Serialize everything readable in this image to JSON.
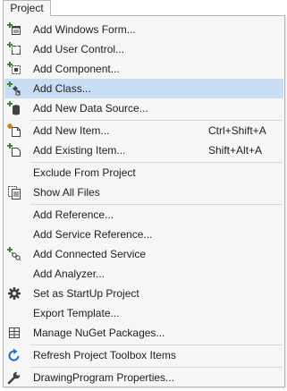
{
  "menubar": {
    "tab_label": "Project"
  },
  "menu": {
    "items": [
      {
        "label": "Add Windows Form...",
        "icon": "windows-form-icon",
        "shortcut": ""
      },
      {
        "label": "Add User Control...",
        "icon": "user-control-icon",
        "shortcut": ""
      },
      {
        "label": "Add Component...",
        "icon": "component-icon",
        "shortcut": ""
      },
      {
        "label": "Add Class...",
        "icon": "class-icon",
        "shortcut": ""
      },
      {
        "label": "Add New Data Source...",
        "icon": "data-source-icon",
        "shortcut": ""
      },
      {
        "label": "Add New Item...",
        "icon": "new-item-icon",
        "shortcut": "Ctrl+Shift+A"
      },
      {
        "label": "Add Existing Item...",
        "icon": "existing-item-icon",
        "shortcut": "Shift+Alt+A"
      },
      {
        "label": "Exclude From Project",
        "icon": "",
        "shortcut": ""
      },
      {
        "label": "Show All Files",
        "icon": "show-all-files-icon",
        "shortcut": ""
      },
      {
        "label": "Add Reference...",
        "icon": "",
        "shortcut": ""
      },
      {
        "label": "Add Service Reference...",
        "icon": "",
        "shortcut": ""
      },
      {
        "label": "Add Connected Service",
        "icon": "connected-service-icon",
        "shortcut": ""
      },
      {
        "label": "Add Analyzer...",
        "icon": "",
        "shortcut": ""
      },
      {
        "label": "Set as StartUp Project",
        "icon": "gear-icon",
        "shortcut": ""
      },
      {
        "label": "Export Template...",
        "icon": "",
        "shortcut": ""
      },
      {
        "label": "Manage NuGet Packages...",
        "icon": "nuget-icon",
        "shortcut": ""
      },
      {
        "label": "Refresh Project Toolbox Items",
        "icon": "refresh-icon",
        "shortcut": ""
      },
      {
        "label": "DrawingProgram Properties...",
        "icon": "wrench-icon",
        "shortcut": ""
      }
    ],
    "highlighted_item": "Add Class...",
    "colors": {
      "menu_background": "#f6f6f6",
      "highlight": "#c9def5",
      "add_plus_green": "#388a34",
      "refresh_blue": "#1e6fc6"
    }
  }
}
